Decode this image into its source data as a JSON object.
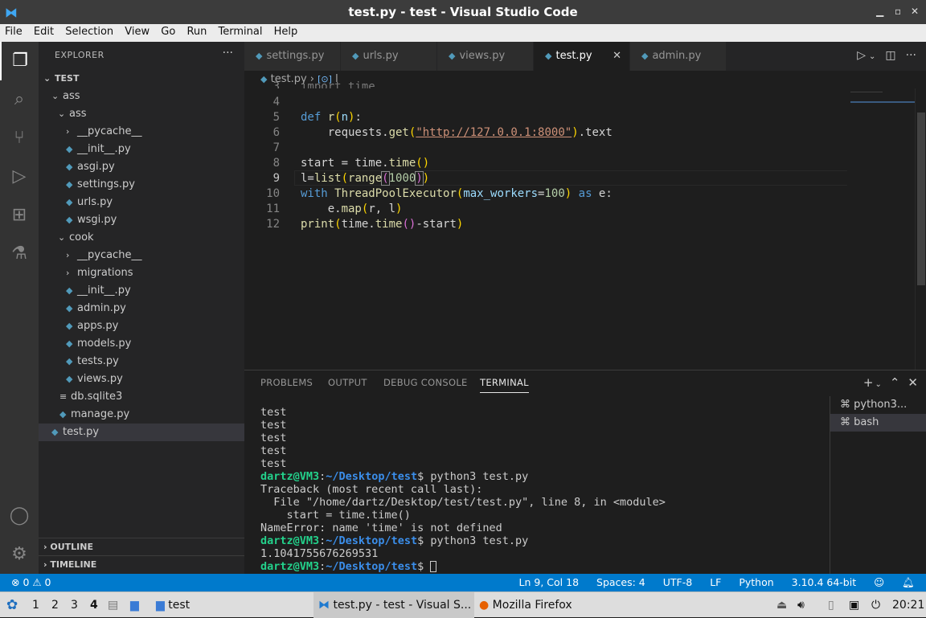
{
  "window": {
    "title": "test.py - test - Visual Studio Code",
    "logo": "vscode-logo-icon",
    "controls": [
      "_",
      "▫",
      "✕"
    ]
  },
  "menu": [
    "File",
    "Edit",
    "Selection",
    "View",
    "Go",
    "Run",
    "Terminal",
    "Help"
  ],
  "activity_icons": [
    "files-icon",
    "search-icon",
    "source-control-icon",
    "run-debug-icon",
    "extensions-icon",
    "testing-icon",
    "account-icon",
    "gear-icon"
  ],
  "sidebar": {
    "header": "EXPLORER",
    "more": "···",
    "root": "TEST",
    "tree": [
      {
        "label": "ass",
        "type": "folder-open"
      },
      {
        "label": "ass",
        "type": "folder-open"
      },
      {
        "label": "__pycache__",
        "type": "folder"
      },
      {
        "label": "__init__.py",
        "type": "py"
      },
      {
        "label": "asgi.py",
        "type": "py"
      },
      {
        "label": "settings.py",
        "type": "py"
      },
      {
        "label": "urls.py",
        "type": "py"
      },
      {
        "label": "wsgi.py",
        "type": "py"
      },
      {
        "label": "cook",
        "type": "folder-open"
      },
      {
        "label": "__pycache__",
        "type": "folder"
      },
      {
        "label": "migrations",
        "type": "folder"
      },
      {
        "label": "__init__.py",
        "type": "py"
      },
      {
        "label": "admin.py",
        "type": "py"
      },
      {
        "label": "apps.py",
        "type": "py"
      },
      {
        "label": "models.py",
        "type": "py"
      },
      {
        "label": "tests.py",
        "type": "py"
      },
      {
        "label": "views.py",
        "type": "py"
      },
      {
        "label": "db.sqlite3",
        "type": "db"
      },
      {
        "label": "manage.py",
        "type": "py"
      },
      {
        "label": "test.py",
        "type": "py"
      }
    ],
    "outline": "OUTLINE",
    "timeline": "TIMELINE"
  },
  "tabs": [
    "settings.py",
    "urls.py",
    "views.py",
    "test.py",
    "admin.py"
  ],
  "breadcrumb": {
    "file": "test.py",
    "symbol": "l"
  },
  "editor": {
    "line_numbers": [
      "3",
      "4",
      "5",
      "6",
      "7",
      "8",
      "9",
      "10",
      "11",
      "12"
    ],
    "partial_top": "import time",
    "cursor": "Ln 9, Col 18"
  },
  "panel": {
    "tabs": [
      "PROBLEMS",
      "OUTPUT",
      "DEBUG CONSOLE",
      "TERMINAL"
    ],
    "active_tab": "TERMINAL",
    "terminals": [
      "python3...",
      "bash"
    ],
    "lines": [
      {
        "t": "test"
      },
      {
        "t": "test"
      },
      {
        "t": "test"
      },
      {
        "t": "test"
      },
      {
        "t": "test"
      },
      {
        "user": "dartz@VM3",
        "path": "~/Desktop/test",
        "cmd": "$ python3 test.py"
      },
      {
        "t": "Traceback (most recent call last):"
      },
      {
        "t": "  File \"/home/dartz/Desktop/test/test.py\", line 8, in <module>"
      },
      {
        "t": "    start = time.time()"
      },
      {
        "t": "NameError: name 'time' is not defined"
      },
      {
        "user": "dartz@VM3",
        "path": "~/Desktop/test",
        "cmd": "$ python3 test.py"
      },
      {
        "t": "1.1041755676269531"
      },
      {
        "user": "dartz@VM3",
        "path": "~/Desktop/test",
        "cmd": "$ "
      }
    ]
  },
  "status": {
    "problems": "⊗ 0 ⚠ 0",
    "position": "Ln 9, Col 18",
    "spaces": "Spaces: 4",
    "encoding": "UTF-8",
    "eol": "LF",
    "lang": "Python",
    "interpreter": "3.10.4 64-bit"
  },
  "taskbar": {
    "workspaces": [
      "1",
      "2",
      "3",
      "4"
    ],
    "folder": "test",
    "vscode": "test.py - test - Visual S...",
    "firefox": "Mozilla Firefox",
    "clock": "20:21"
  }
}
